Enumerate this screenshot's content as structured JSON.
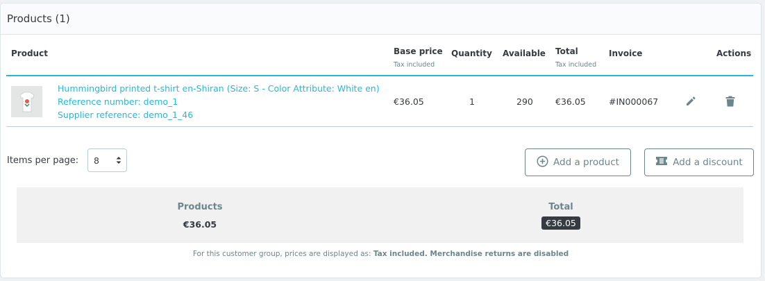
{
  "card": {
    "title": "Products (1)"
  },
  "table": {
    "headers": {
      "product": "Product",
      "base_price": "Base price",
      "base_price_sub": "Tax included",
      "quantity": "Quantity",
      "available": "Available",
      "total": "Total",
      "total_sub": "Tax included",
      "invoice": "Invoice",
      "actions": "Actions"
    },
    "rows": [
      {
        "name": "Hummingbird printed t-shirt en-Shiran (Size: S - Color Attribute: White en)",
        "reference": "Reference number: demo_1",
        "supplier_reference": "Supplier reference: demo_1_46",
        "base_price": "€36.05",
        "quantity": "1",
        "available": "290",
        "total": "€36.05",
        "invoice": "#IN000067",
        "edit_icon": "pencil-icon",
        "delete_icon": "trash-icon"
      }
    ]
  },
  "pagination": {
    "label": "Items per page:",
    "selected": "8"
  },
  "buttons": {
    "add_product": "Add a product",
    "add_product_icon": "plus-circle-icon",
    "add_discount": "Add a discount",
    "add_discount_icon": "ticket-icon"
  },
  "summary": {
    "products_label": "Products",
    "products_value": "€36.05",
    "total_label": "Total",
    "total_value": "€36.05"
  },
  "footer_note": {
    "prefix": "For this customer group, prices are displayed as: ",
    "tax": "Tax included",
    "returns": "Merchandise returns are disabled"
  },
  "colors": {
    "accent": "#25b9d7",
    "text": "#363a41",
    "muted": "#6c868e"
  }
}
